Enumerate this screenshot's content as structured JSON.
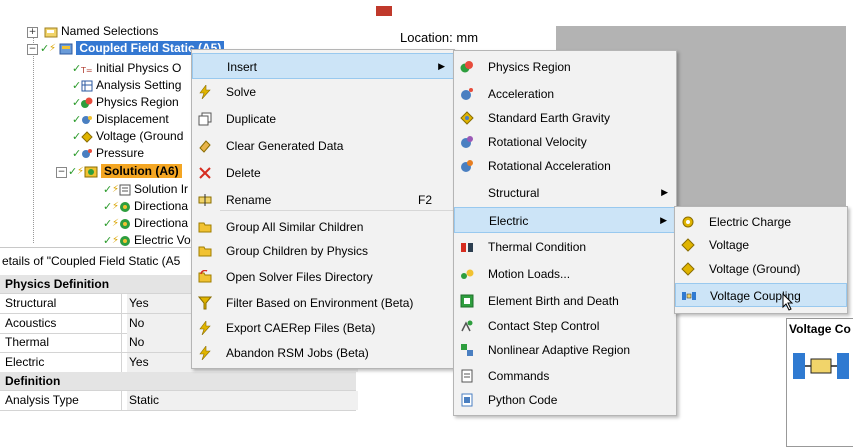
{
  "tree": {
    "named_selections": "Named Selections",
    "analysis": "Coupled Field Static (A5)",
    "children": [
      "Initial Physics O",
      "Analysis Setting",
      "Physics Region",
      "Displacement",
      "Voltage (Ground",
      "Pressure"
    ],
    "solution": "Solution (A6)",
    "solution_children": [
      "Solution Ir",
      "Directiona",
      "Directiona",
      "Electric Vo"
    ]
  },
  "details": {
    "title": "etails of \"Coupled Field Static (A5",
    "rows": [
      {
        "type": "cat",
        "label": "Physics Definition"
      },
      {
        "type": "row",
        "key": "Structural",
        "value": "Yes"
      },
      {
        "type": "row",
        "key": "Acoustics",
        "value": "No"
      },
      {
        "type": "row",
        "key": "Thermal",
        "value": "No"
      },
      {
        "type": "row",
        "key": "Electric",
        "value": "Yes"
      },
      {
        "type": "cat",
        "label": "Definition"
      },
      {
        "type": "row",
        "key": "Analysis Type",
        "value": "Static"
      }
    ]
  },
  "geometry": {
    "location_label": "Location:",
    "location_value": "mm"
  },
  "context_menu": {
    "items": [
      {
        "label": "Insert",
        "icon": "",
        "submenu": true,
        "highlight": true
      },
      {
        "label": "Solve",
        "icon": "solve-icon"
      },
      {
        "label": "Duplicate",
        "icon": "duplicate-icon"
      },
      {
        "label": "Clear Generated Data",
        "icon": "eraser-icon"
      },
      {
        "label": "Delete",
        "icon": "delete-icon"
      },
      {
        "label": "Rename",
        "icon": "rename-icon",
        "shortcut": "F2"
      },
      {
        "label": "Group All Similar Children",
        "icon": "folder-icon"
      },
      {
        "label": "Group Children by Physics",
        "icon": "folder-icon"
      },
      {
        "label": "Open Solver Files Directory",
        "icon": "open-folder-icon"
      },
      {
        "label": "Filter Based on Environment (Beta)",
        "icon": "filter-icon"
      },
      {
        "label": "Export CAERep Files (Beta)",
        "icon": "export-icon"
      },
      {
        "label": "Abandon RSM Jobs (Beta)",
        "icon": "abandon-icon"
      }
    ]
  },
  "insert_menu": {
    "items": [
      {
        "label": "Physics Region"
      },
      {
        "label": "Acceleration"
      },
      {
        "label": "Standard Earth Gravity"
      },
      {
        "label": "Rotational Velocity"
      },
      {
        "label": "Rotational Acceleration"
      },
      {
        "label": "Structural",
        "submenu": true
      },
      {
        "label": "Electric",
        "submenu": true,
        "highlight": true
      },
      {
        "label": "Thermal Condition"
      },
      {
        "label": "Motion Loads..."
      },
      {
        "label": "Element Birth and Death"
      },
      {
        "label": "Contact Step Control"
      },
      {
        "label": "Nonlinear Adaptive Region"
      },
      {
        "label": "Commands"
      },
      {
        "label": "Python Code"
      }
    ]
  },
  "electric_menu": {
    "items": [
      {
        "label": "Electric Charge"
      },
      {
        "label": "Voltage"
      },
      {
        "label": "Voltage (Ground)"
      },
      {
        "label": "Voltage Coupling",
        "highlight": true
      }
    ]
  },
  "preview_panel": {
    "title": "Voltage Co"
  }
}
